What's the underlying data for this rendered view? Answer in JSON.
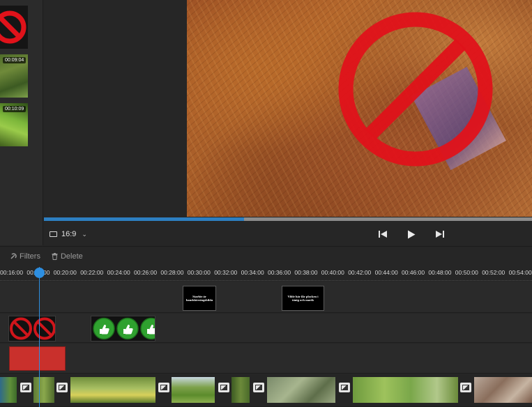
{
  "media_bin": {
    "items": [
      {
        "kind": "no-sign",
        "time": ""
      },
      {
        "kind": "grass",
        "time": "00:09:04"
      },
      {
        "kind": "grass",
        "time": "00:10:09"
      }
    ]
  },
  "viewer": {
    "aspect_label": "16:9",
    "progress": 0.41
  },
  "toolbar": {
    "filters_label": "Filters",
    "delete_label": "Delete"
  },
  "ruler": {
    "ticks": [
      "00:16:00",
      "00:18:00",
      "00:20:00",
      "00:22:00",
      "00:24:00",
      "00:26:00",
      "00:28:00",
      "00:30:00",
      "00:32:00",
      "00:34:00",
      "00:36:00",
      "00:38:00",
      "00:40:00",
      "00:42:00",
      "00:44:00",
      "00:46:00",
      "00:48:00",
      "00:50:00",
      "00:52:00",
      "00:54:00"
    ]
  },
  "timeline": {
    "title_clips": [
      {
        "text": "Starbie är handskörsingsbilda"
      },
      {
        "text": "Vilde här får plocken i tänig och marik"
      }
    ]
  },
  "colors": {
    "accent": "#2d8ee0",
    "progress": "#2d7fc1",
    "red_clip": "#c9302c",
    "no_sign": "#e0121a",
    "thumb_green": "#2fa12f"
  }
}
